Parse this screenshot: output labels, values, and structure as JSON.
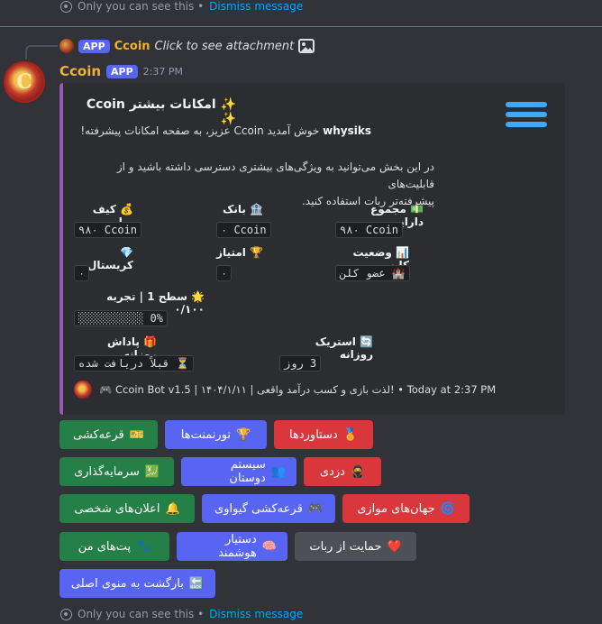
{
  "ephemeral_top": {
    "text": "Only you can see this •",
    "dismiss": "Dismiss message"
  },
  "ephemeral_bottom": {
    "text": "Only you can see this •",
    "dismiss": "Dismiss message"
  },
  "reply": {
    "badge": "APP",
    "name": "Ccoin",
    "text": "Click to see attachment"
  },
  "message": {
    "author": "Ccoin",
    "badge": "APP",
    "time": "2:37 PM",
    "avatar_letter": "C"
  },
  "embed": {
    "title": "✨ امکانات بیشتر Ccoin ✨",
    "greeting_user": "whysiks",
    "greeting_rest": " خوش آمدید Ccoin عزیز، به صفحه امکانات پیشرفته!",
    "desc_line1": "در این بخش می‌توانید به ویژگی‌های بیشتری دسترسی داشته باشید و از قابلیت‌های",
    "desc_line2": "پیشرفته‌تر ربات استفاده کنید.",
    "fields": [
      {
        "label": "💵 مجموع دارایی",
        "value": "۹۸۰ Ccoin"
      },
      {
        "label": "🏦 بانک",
        "value": "۰ Ccoin"
      },
      {
        "label": "💰 کیف پول",
        "value": "۹۸۰ Ccoin"
      },
      {
        "label": "📊 وضعیت کلن",
        "value": "🏰 عضو کلن"
      },
      {
        "label": "🏆 امتیاز",
        "value": "۰"
      },
      {
        "label": "💎 کریستال",
        "value": "۰"
      },
      {
        "label": "🌟 سطح 1 | تجربه ۰/۱۰۰",
        "value": "░░░░░░░░░░ 0%"
      },
      {
        "label": "🔄 استریک روزانه",
        "value": "3 روز"
      },
      {
        "label": "🎁 پاداش روزانه",
        "value": "⏳ قبلاً دریافت شده"
      }
    ],
    "footer": "🎮 Ccoin Bot v1.5 | ۱۴۰۴/۱/۱۱ | لذت بازی و کسب درآمد واقعی! • Today at 2:37 PM"
  },
  "buttons": [
    {
      "label": "دستاوردها",
      "icon": "🏅"
    },
    {
      "label": "تورنمنت‌ها",
      "icon": "🏆"
    },
    {
      "label": "قرعه‌کشی",
      "icon": "🎫"
    },
    {
      "label": "دزدی",
      "icon": "🥷"
    },
    {
      "label": "سیستم دوستان",
      "icon": "👥"
    },
    {
      "label": "سرمایه‌گذاری",
      "icon": "💹"
    },
    {
      "label": "جهان‌های موازی",
      "icon": "🌀"
    },
    {
      "label": "قرعه‌کشی گیواوی",
      "icon": "🎮"
    },
    {
      "label": "اعلان‌های شخصی",
      "icon": "🔔"
    },
    {
      "label": "حمایت از ربات",
      "icon": "❤️"
    },
    {
      "label": "دستیار هوشمند",
      "icon": "🧠"
    },
    {
      "label": "پت‌های من",
      "icon": "🐾"
    },
    {
      "label": "بازگشت به منوی اصلی",
      "icon": "🔙"
    }
  ]
}
